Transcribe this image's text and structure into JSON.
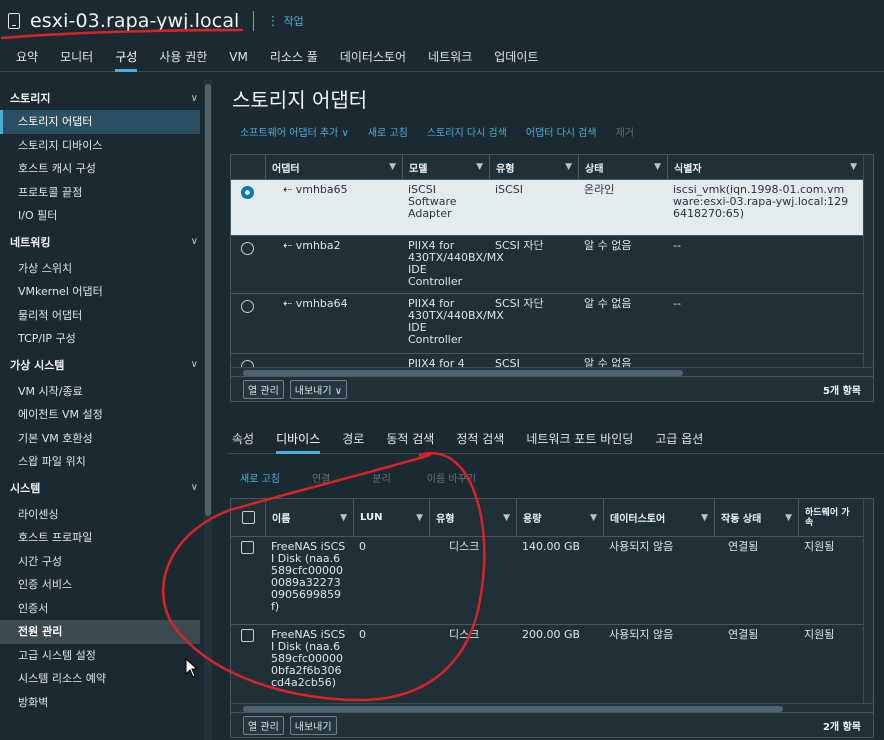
{
  "header": {
    "title": "esxi-03.rapa-ywj.local",
    "actions": "작업",
    "host_icon": "server-icon"
  },
  "tabs": [
    "요약",
    "모니터",
    "구성",
    "사용 권한",
    "VM",
    "리소스 풀",
    "데이터스토어",
    "네트워크",
    "업데이트"
  ],
  "active_tab": "구성",
  "sidebar": {
    "sections": [
      {
        "label": "스토리지",
        "items": [
          "스토리지 어댑터",
          "스토리지 디바이스",
          "호스트 캐시 구성",
          "프로토콜 끝점",
          "I/O 필터"
        ]
      },
      {
        "label": "네트워킹",
        "items": [
          "가상 스위치",
          "VMkernel 어댑터",
          "물리적 어댑터",
          "TCP/IP 구성"
        ]
      },
      {
        "label": "가상 시스템",
        "items": [
          "VM 시작/종료",
          "에이전트 VM 설정",
          "기본 VM 호환성",
          "스왑 파일 위치"
        ]
      },
      {
        "label": "시스템",
        "items": [
          "라이센싱",
          "호스트 프로파일",
          "시간 구성",
          "인증 서비스",
          "인증서",
          "전원 관리",
          "고급 시스템 설정",
          "시스템 리소스 예약",
          "방화벽"
        ]
      }
    ],
    "selected": "스토리지 어댑터",
    "hovered": "전원 관리"
  },
  "main": {
    "title": "스토리지 어댑터",
    "toolbar": [
      "소프트웨어 어댑터 추가 ∨",
      "새로 고침",
      "스토리지 다시 검색",
      "어댑터 다시 검색",
      "제거"
    ],
    "adapters": {
      "columns": [
        "어댑터",
        "모델",
        "유형",
        "상태",
        "식별자"
      ],
      "rows": [
        {
          "name": "vmhba65",
          "model": "iSCSI Software Adapter",
          "type": "iSCSI",
          "status": "온라인",
          "id": "iscsi_vmk(iqn.1998-01.com.vmware:esxi-03.rapa-ywj.local:1296418270:65)",
          "selected": true
        },
        {
          "name": "vmhba2",
          "model": "PIIX4 for 430TX/440BX/MX IDE Controller",
          "type": "SCSI 자단",
          "status": "알 수 없음",
          "id": "--",
          "selected": false
        },
        {
          "name": "vmhba64",
          "model": "PIIX4 for 430TX/440BX/MX IDE Controller",
          "type": "SCSI 자단",
          "status": "알 수 없음",
          "id": "--",
          "selected": false
        },
        {
          "name": "",
          "model": "PIIX4 for 4",
          "type": "SCSI",
          "status": "알 수 없음",
          "id": "",
          "selected": false
        }
      ],
      "footer_buttons": [
        "열 관리",
        "내보내기 ∨"
      ],
      "count": "5개 항목"
    },
    "subtabs": [
      "속성",
      "디바이스",
      "경로",
      "동적 검색",
      "정적 검색",
      "네트워크 포트 바인딩",
      "고급 옵션"
    ],
    "active_subtab": "디바이스",
    "device_toolbar": [
      "새로 고침",
      "연결",
      "분리",
      "이름 바꾸기"
    ],
    "devices": {
      "columns": [
        "이름",
        "LUN",
        "유형",
        "용량",
        "데이터스토어",
        "작동 상태",
        "하드웨어 가속"
      ],
      "rows": [
        {
          "name": "FreeNAS iSCSI Disk (naa.6589cfc000000089a322730905699859f)",
          "lun": "0",
          "type": "디스크",
          "capacity": "140.00 GB",
          "datastore": "사용되지 않음",
          "state": "연결됨",
          "accel": "지원됨"
        },
        {
          "name": "FreeNAS iSCSI Disk (naa.6589cfc000000bfa2f6b306cd4a2cb56)",
          "lun": "0",
          "type": "디스크",
          "capacity": "200.00 GB",
          "datastore": "사용되지 않음",
          "state": "연결됨",
          "accel": "지원됨"
        }
      ],
      "footer_buttons": [
        "열 관리",
        "내보내기"
      ],
      "count": "2개 항목"
    }
  },
  "colors": {
    "accent": "#49afd9",
    "annotation": "#d8232a",
    "background": "#1b2a32"
  }
}
